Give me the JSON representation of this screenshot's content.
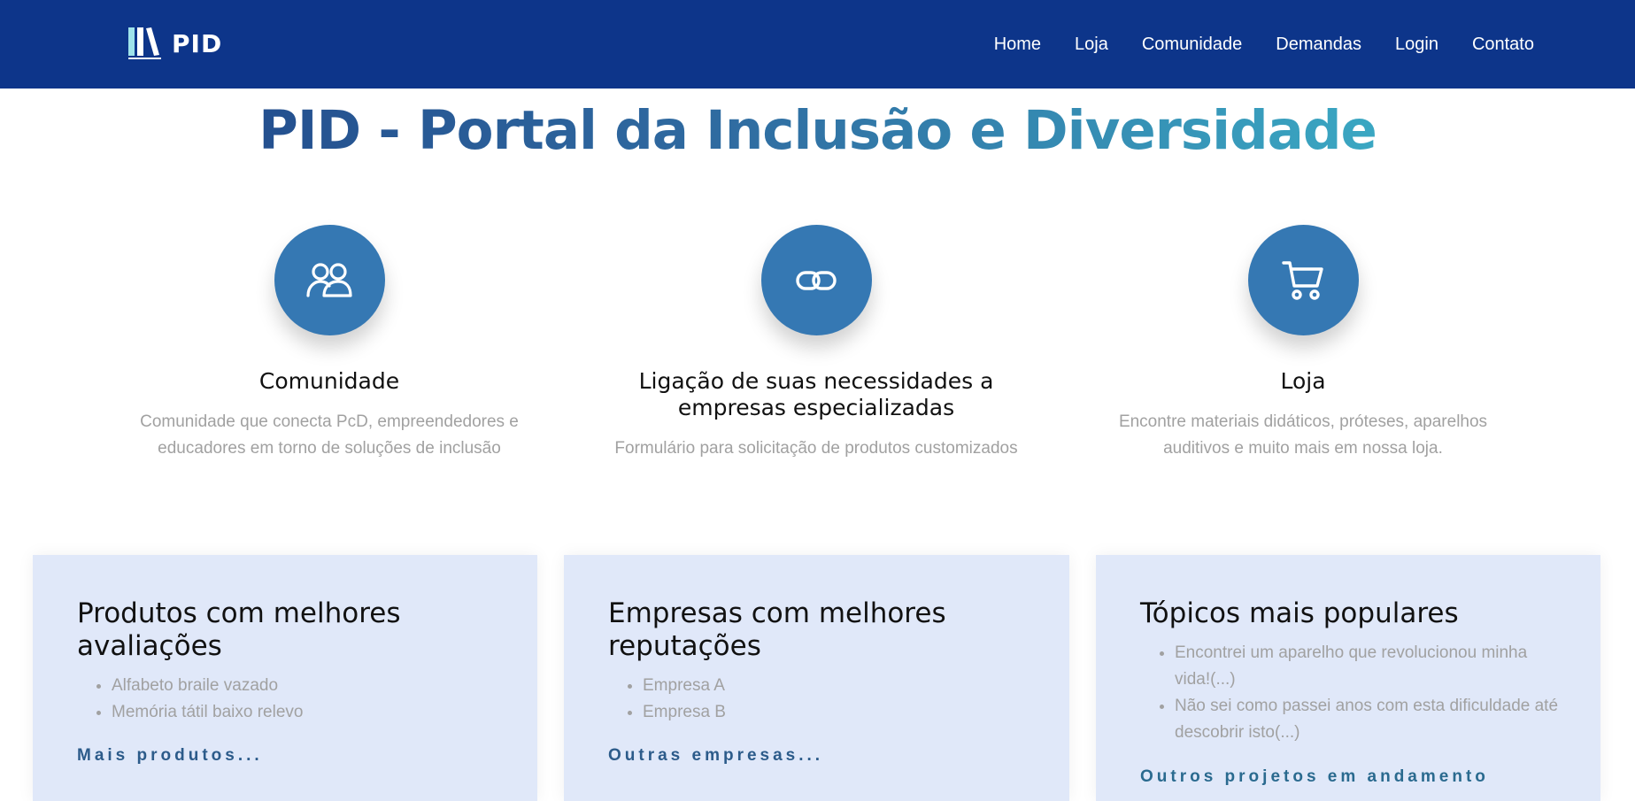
{
  "header": {
    "logo_text": "PID",
    "nav": [
      "Home",
      "Loja",
      "Comunidade",
      "Demandas",
      "Login",
      "Contato"
    ]
  },
  "hero": {
    "title": "PID - Portal da Inclusão e Diversidade"
  },
  "features": [
    {
      "icon": "users-icon",
      "title": "Comunidade",
      "text": "Comunidade que conecta PcD, empreendedores e educadores em torno de soluções de inclusão"
    },
    {
      "icon": "link-icon",
      "title": "Ligação de suas necessidades a empresas especializadas",
      "text": "Formulário para solicitação de produtos customizados"
    },
    {
      "icon": "cart-icon",
      "title": "Loja",
      "text": "Encontre materiais didáticos, próteses, aparelhos auditivos e muito mais em nossa loja."
    }
  ],
  "cards": [
    {
      "title": "Produtos com melhores avaliações",
      "items": [
        "Alfabeto braile vazado",
        "Memória tátil baixo relevo"
      ],
      "link": "Mais produtos..."
    },
    {
      "title": "Empresas com melhores reputações",
      "items": [
        "Empresa A",
        "Empresa B"
      ],
      "link": "Outras empresas..."
    },
    {
      "title": "Tópicos mais populares",
      "items": [
        "Encontrei um aparelho que revolucionou minha vida!(...)",
        "Não sei como passei anos com esta dificuldade até descobrir isto(...)"
      ],
      "link": "Outros projetos em andamento"
    }
  ],
  "colors": {
    "navbar": "#0d358a",
    "accent_circle": "#3578b3",
    "card_bg": "#e0e8f9",
    "muted_text": "#a1a1a1"
  }
}
